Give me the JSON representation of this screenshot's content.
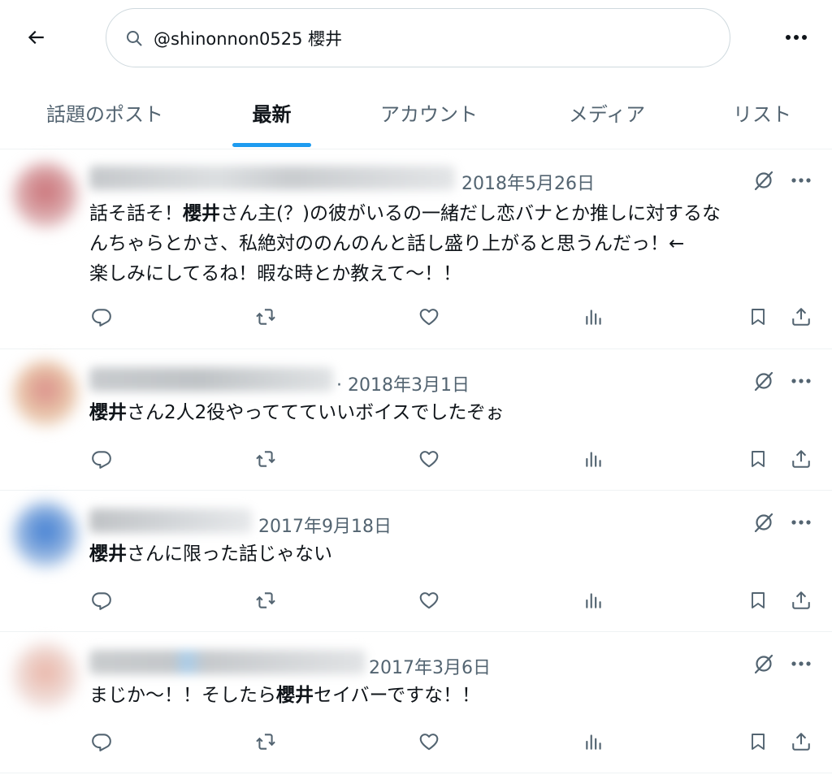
{
  "header": {
    "back_icon": "arrow-left-icon",
    "search_value": "@shinonnon0525 櫻井",
    "more_icon": "ellipsis-icon"
  },
  "tabs": [
    {
      "label": "話題のポスト",
      "active": false
    },
    {
      "label": "最新",
      "active": true
    },
    {
      "label": "アカウント",
      "active": false
    },
    {
      "label": "メディア",
      "active": false
    },
    {
      "label": "リスト",
      "active": false
    }
  ],
  "accent_color": "#1d9bf0",
  "posts": [
    {
      "date": "2018年5月26日",
      "lines": [
        [
          {
            "t": "話そ話そ！"
          },
          {
            "t": "櫻井",
            "b": true
          },
          {
            "t": "さん主(？)の彼がいるの一緒だし恋バナとか推しに対するな"
          }
        ],
        [
          {
            "t": "んちゃらとかさ、私絶対ののんのんと話し盛り上がると思うんだっ！←"
          }
        ],
        [
          {
            "t": "楽しみにしてるね！暇な時とか教えて〜！！"
          }
        ]
      ]
    },
    {
      "date": "· 2018年3月1日",
      "lines": [
        [
          {
            "t": "櫻井",
            "b": true
          },
          {
            "t": "さん2人2役やっててていいボイスでしたぞぉ"
          }
        ]
      ]
    },
    {
      "date": "2017年9月18日",
      "lines": [
        [
          {
            "t": "櫻井",
            "b": true
          },
          {
            "t": "さんに限った話じゃない"
          }
        ]
      ]
    },
    {
      "date": "2017年3月6日",
      "lines": [
        [
          {
            "t": "まじか〜！！そしたら"
          },
          {
            "t": "櫻井",
            "b": true
          },
          {
            "t": "セイバーですな！！"
          }
        ]
      ]
    }
  ],
  "action_icons": [
    "reply-icon",
    "repost-icon",
    "like-icon",
    "views-icon",
    "bookmark-icon",
    "share-icon"
  ]
}
